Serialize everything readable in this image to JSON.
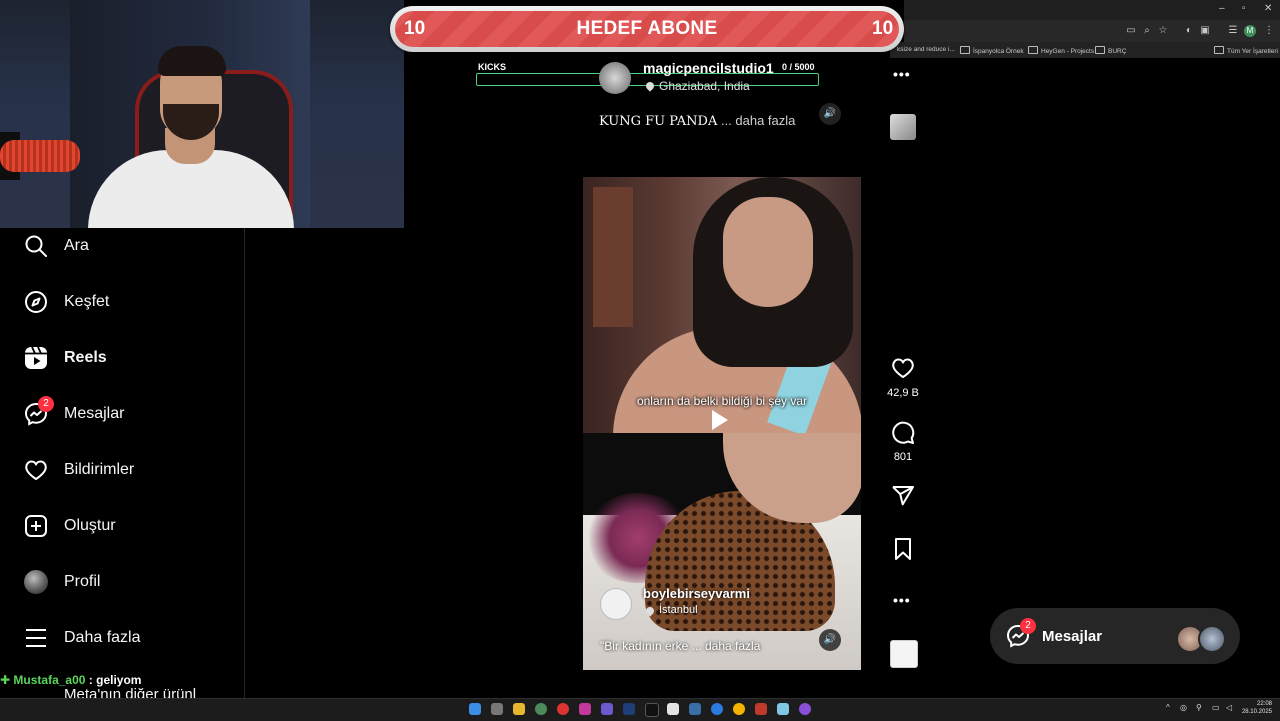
{
  "browser": {
    "bookmarks": [
      {
        "label": "ksize and reduce i..."
      },
      {
        "label": "İspanyolca Örnek"
      },
      {
        "label": "HeyGen - Projects"
      },
      {
        "label": "BURÇ"
      },
      {
        "label": "Tüm Yer İşaretleri"
      }
    ],
    "profile_initial": "M"
  },
  "overlay": {
    "goal_left": "10",
    "goal_title": "HEDEF ABONE",
    "goal_right": "10",
    "kicks_label": "KICKS",
    "kicks_count": "0  / 5000",
    "kicks_progress": 0,
    "chat": {
      "user": "Mustafa_a00",
      "separator": " : ",
      "message": "geliyom"
    }
  },
  "sidebar": {
    "items": [
      {
        "label": "Ara",
        "icon": "search-icon"
      },
      {
        "label": "Keşfet",
        "icon": "compass-icon"
      },
      {
        "label": "Reels",
        "icon": "reels-icon"
      },
      {
        "label": "Mesajlar",
        "icon": "messenger-icon",
        "badge": "2"
      },
      {
        "label": "Bildirimler",
        "icon": "heart-icon"
      },
      {
        "label": "Oluştur",
        "icon": "plus-square-icon"
      },
      {
        "label": "Profil",
        "icon": "avatar"
      },
      {
        "label": "Daha fazla",
        "icon": "menu-icon"
      }
    ],
    "meta_more": "Meta'nın diğer ürünl"
  },
  "reel_top": {
    "username": "magicpencilstudio1",
    "location": "Ghaziabad, India",
    "caption": "KUNG FU PANDA",
    "more": " ... daha fazla"
  },
  "reel_current": {
    "subtitle": "onların da belki bildiği bi şey var",
    "username": "boylebirseyvarmi",
    "location": "İstanbul",
    "caption": "\"Bir kadının erke",
    "more": " ... daha fazla",
    "likes": "42,9 B",
    "comments": "801"
  },
  "messages_panel": {
    "label": "Mesajlar",
    "badge": "2"
  },
  "clock": {
    "time": "22:08",
    "date": "28.10.2025"
  },
  "colors": {
    "accent_badge": "#ff3040",
    "goal_red": "#e15858",
    "kicks_green": "#4cd27a",
    "chat_user": "#5ad65a"
  }
}
